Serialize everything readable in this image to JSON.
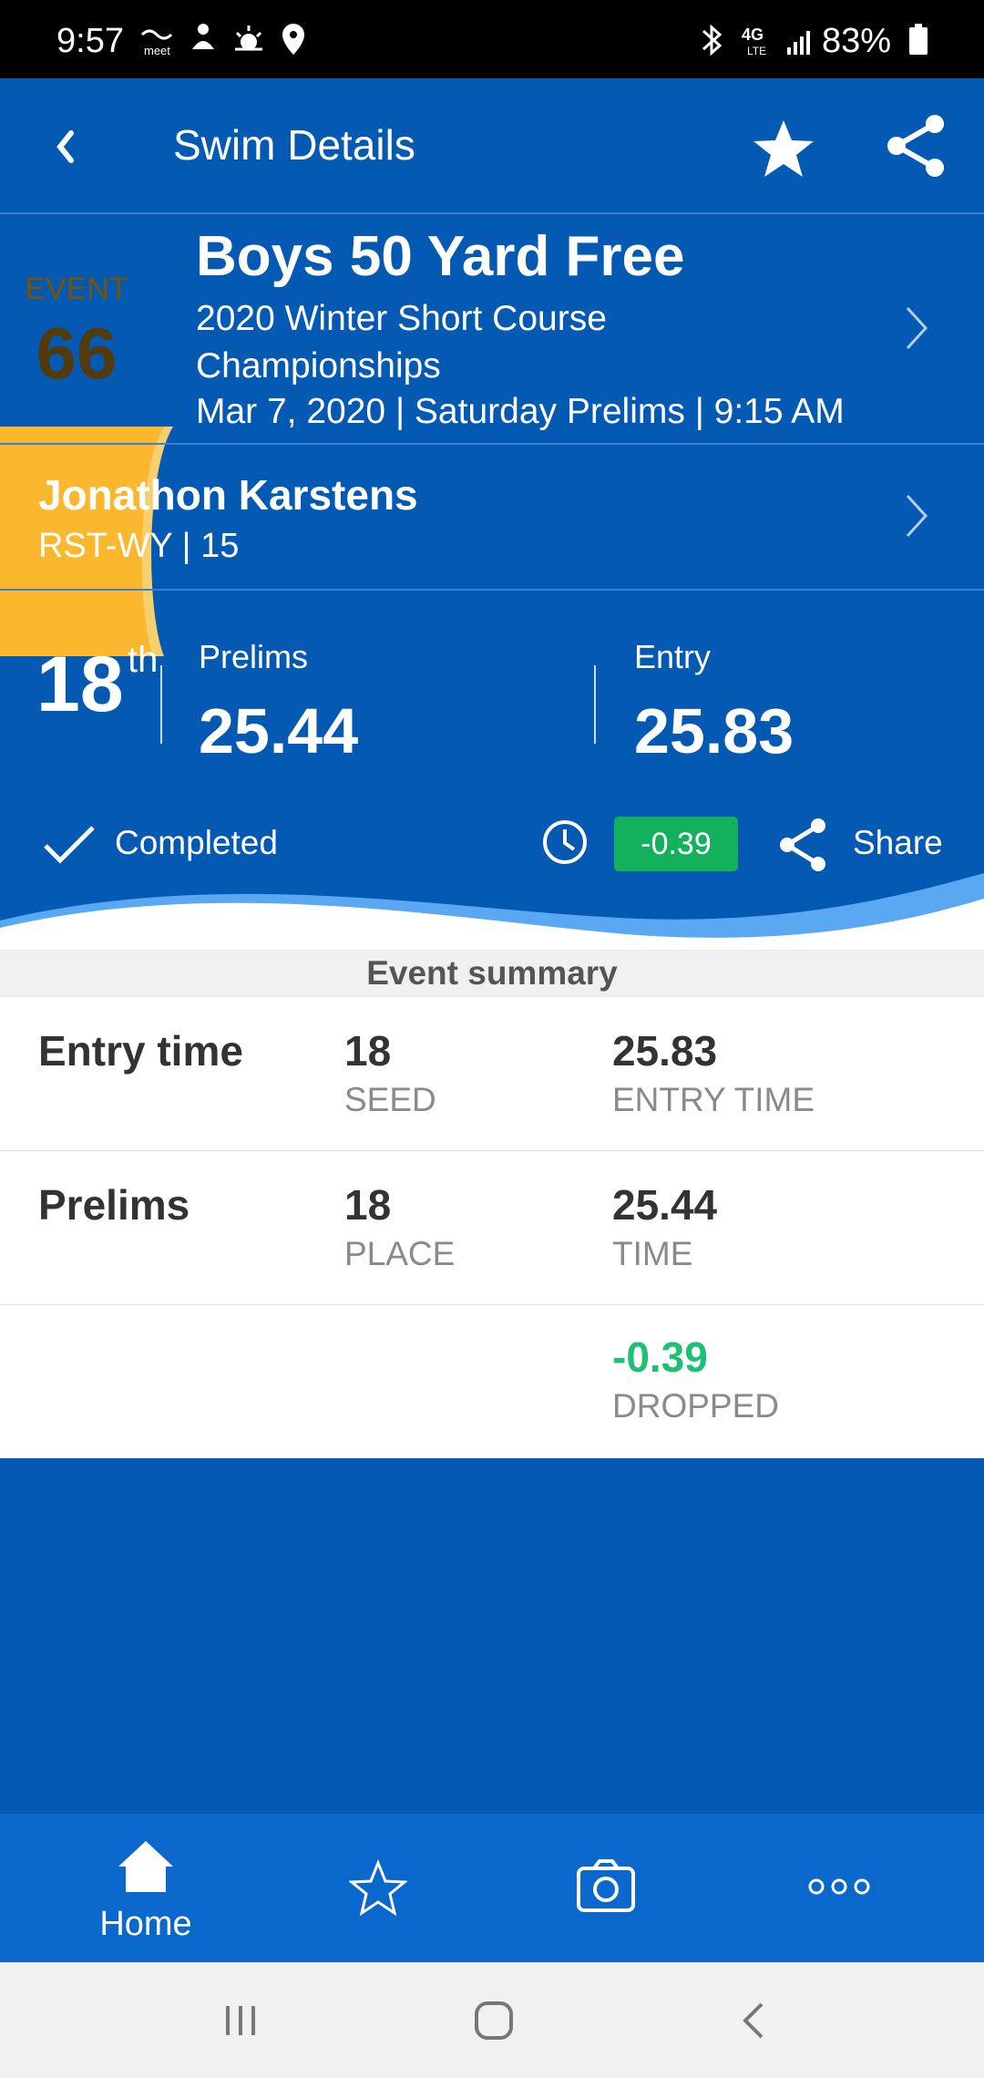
{
  "status_bar": {
    "time": "9:57",
    "battery": "83%",
    "icons": [
      "meet-icon",
      "swimmer-icon",
      "weather-icon",
      "location-icon",
      "bluetooth-icon",
      "lte-icon",
      "signal-icon",
      "battery-icon"
    ]
  },
  "header": {
    "title": "Swim Details",
    "back_icon": "chevron-left-icon",
    "actions": [
      "star-icon",
      "share-icon"
    ]
  },
  "event": {
    "label": "EVENT",
    "number": "66",
    "title": "Boys 50 Yard Free",
    "meet": "2020 Winter Short Course Championships",
    "date_line": "Mar 7, 2020 | Saturday Prelims | 9:15 AM"
  },
  "swimmer": {
    "name": "Jonathon Karstens",
    "team_age": "RST-WY | 15"
  },
  "result": {
    "place": "18",
    "place_suffix": "th",
    "prelims_label": "Prelims",
    "prelims_time": "25.44",
    "entry_label": "Entry",
    "entry_time": "25.83",
    "status": "Completed",
    "time_drop": "-0.39",
    "share_label": "Share"
  },
  "summary": {
    "heading": "Event summary",
    "rows": [
      {
        "label": "Entry time",
        "col1_value": "18",
        "col1_sub": "SEED",
        "col2_value": "25.83",
        "col2_sub": "ENTRY TIME"
      },
      {
        "label": "Prelims",
        "col1_value": "18",
        "col1_sub": "PLACE",
        "col2_value": "25.44",
        "col2_sub": "TIME"
      },
      {
        "label": "",
        "col1_value": "",
        "col1_sub": "",
        "col2_value": "-0.39",
        "col2_sub": "DROPPED"
      }
    ]
  },
  "bottom_nav": {
    "home_label": "Home",
    "items": [
      "home-icon",
      "star-outline-icon",
      "camera-icon",
      "more-icon"
    ]
  },
  "colors": {
    "primary_blue": "#0459b3",
    "nav_blue": "#0a67cc",
    "event_badge": "#fbb72e",
    "drop_green": "#13b15b",
    "wave_light_blue": "#5aa7f2"
  }
}
